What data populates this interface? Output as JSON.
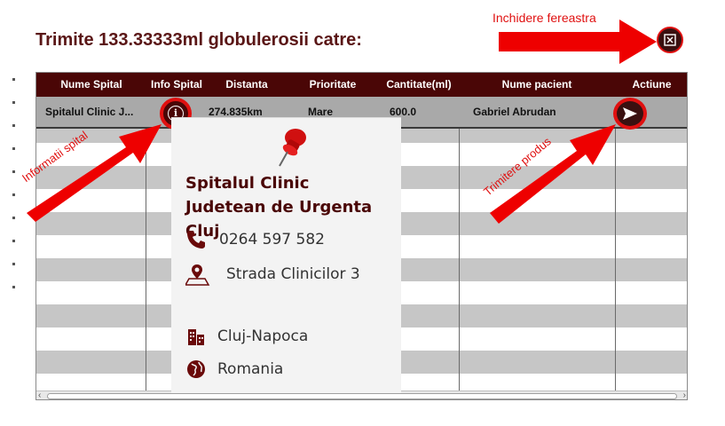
{
  "dialog": {
    "title": "Trimite 133.33333ml globulerosii catre:",
    "close_annotation": "Inchidere fereastra"
  },
  "annotations": {
    "info": "Informatii spital",
    "send": "Trimitere produs"
  },
  "table": {
    "columns": [
      "Nume Spital",
      "Info Spital",
      "Distanta",
      "Prioritate",
      "Cantitate(ml)",
      "Nume pacient",
      "Actiune"
    ],
    "rows": [
      {
        "hospital": "Spitalul Clinic J...",
        "distance": "274.835km",
        "priority": "Mare",
        "quantity": "600.0",
        "patient": "Gabriel Abrudan"
      }
    ]
  },
  "popup": {
    "hospital_name": "Spitalul Clinic Judetean de Urgenta Cluj",
    "phone": "0264 597 582",
    "address": "Strada Clinicilor 3",
    "city": "Cluj-Napoca",
    "country": "Romania"
  },
  "colors": {
    "header": "#4a0606",
    "accent_red": "#e01010",
    "row_selected": "#a9a9a9"
  },
  "icons": [
    "close-icon",
    "info-icon",
    "send-icon",
    "pin-icon",
    "phone-icon",
    "map-marker-icon",
    "building-icon",
    "globe-icon"
  ]
}
